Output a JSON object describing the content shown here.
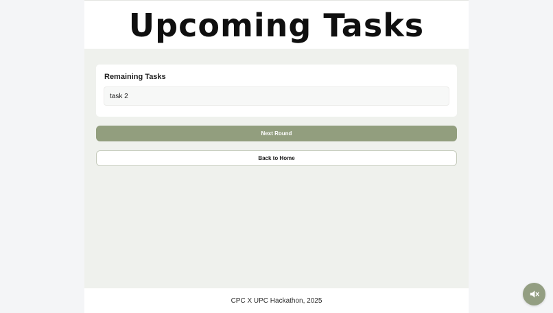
{
  "header": {
    "title": "Upcoming Tasks"
  },
  "remaining": {
    "title": "Remaining Tasks",
    "tasks": [
      "task 2"
    ]
  },
  "actions": {
    "next_round_label": "Next Round",
    "back_home_label": "Back to Home"
  },
  "footer": {
    "text": "CPC X UPC Hackathon, 2025"
  },
  "fab": {
    "icon": "speaker-muted-icon"
  },
  "colors": {
    "accent": "#929e7e",
    "panel_background": "#eff1ed",
    "page_background": "#f4f5f7"
  }
}
